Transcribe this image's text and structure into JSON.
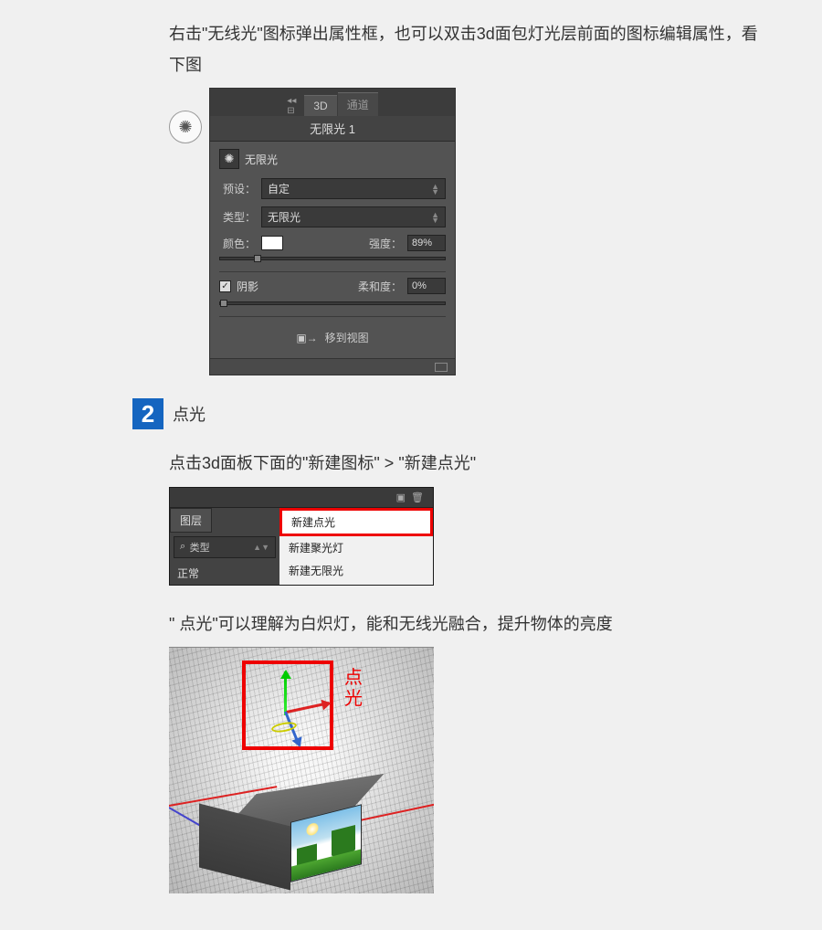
{
  "intro": "右击\"无线光\"图标弹出属性框，也可以双击3d面包灯光层前面的图标编辑属性，看下图",
  "panel1": {
    "tabs": {
      "t1": "3D",
      "t2": "通道"
    },
    "title": "无限光 1",
    "light_type_label": "无限光",
    "preset_label": "预设：",
    "preset_value": "自定",
    "type_label": "类型：",
    "type_value": "无限光",
    "color_label": "颜色：",
    "intensity_label": "强度：",
    "intensity_value": "89%",
    "shadow_label": "阴影",
    "softness_label": "柔和度：",
    "softness_value": "0%",
    "move_label": "移到视图"
  },
  "step": {
    "num": "2",
    "title": "点光"
  },
  "para2": "点击3d面板下面的\"新建图标\" > \"新建点光\"",
  "panel2": {
    "layers_tab": "图层",
    "search_label": "类型",
    "search_icon": "⌕",
    "mode": "正常",
    "menu": {
      "i1": "新建点光",
      "i2": "新建聚光灯",
      "i3": "新建无限光"
    }
  },
  "para3": "\" 点光\"可以理解为白炽灯，能和无线光融合，提升物体的亮度",
  "panel3": {
    "anno_l1": "点",
    "anno_l2": "光"
  }
}
